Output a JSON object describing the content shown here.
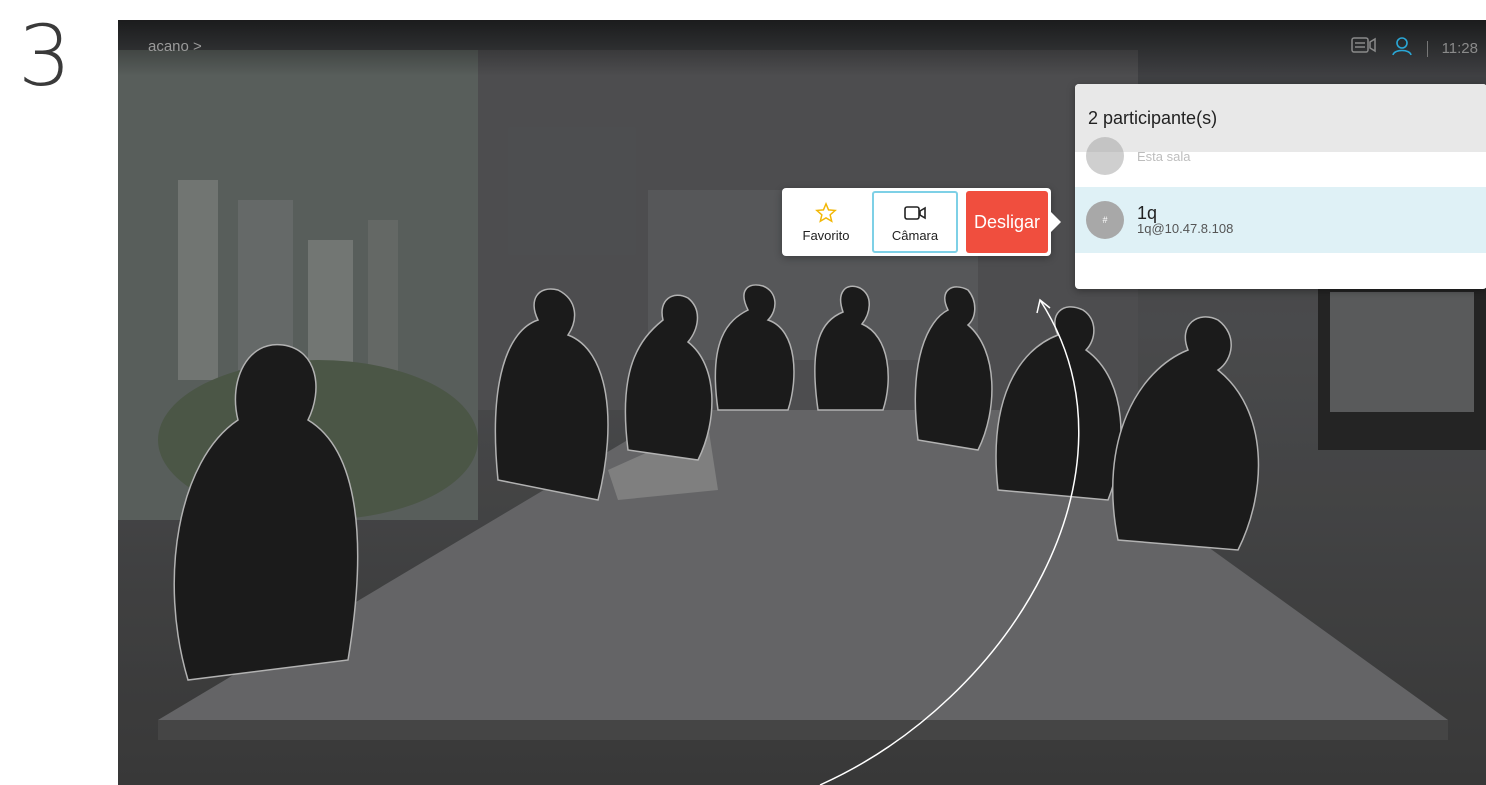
{
  "step": {
    "number": "3"
  },
  "topbar": {
    "breadcrumb": "acano >",
    "time": "11:28",
    "icons": [
      "layout-icon",
      "participants-icon"
    ]
  },
  "participants_panel": {
    "title": "2 participante(s)",
    "items": [
      {
        "name": "",
        "subtitle": "Esta sala",
        "avatar_icon": "avatar-icon"
      },
      {
        "name": "1q",
        "address": "1q@10.47.8.108",
        "avatar_icon": "hash-avatar-icon",
        "avatar_text": "#"
      }
    ]
  },
  "actions": {
    "favorite_label": "Favorito",
    "camera_label": "Câmara",
    "hangup_label": "Desligar",
    "favorite_icon": "star-icon",
    "camera_icon": "camera-icon"
  },
  "colors": {
    "hangup": "#f04e3e",
    "selected_row": "#dff1f6",
    "camera_outline": "#7ed0e6",
    "star": "#f2b705",
    "participants_icon": "#2aa7d6"
  }
}
